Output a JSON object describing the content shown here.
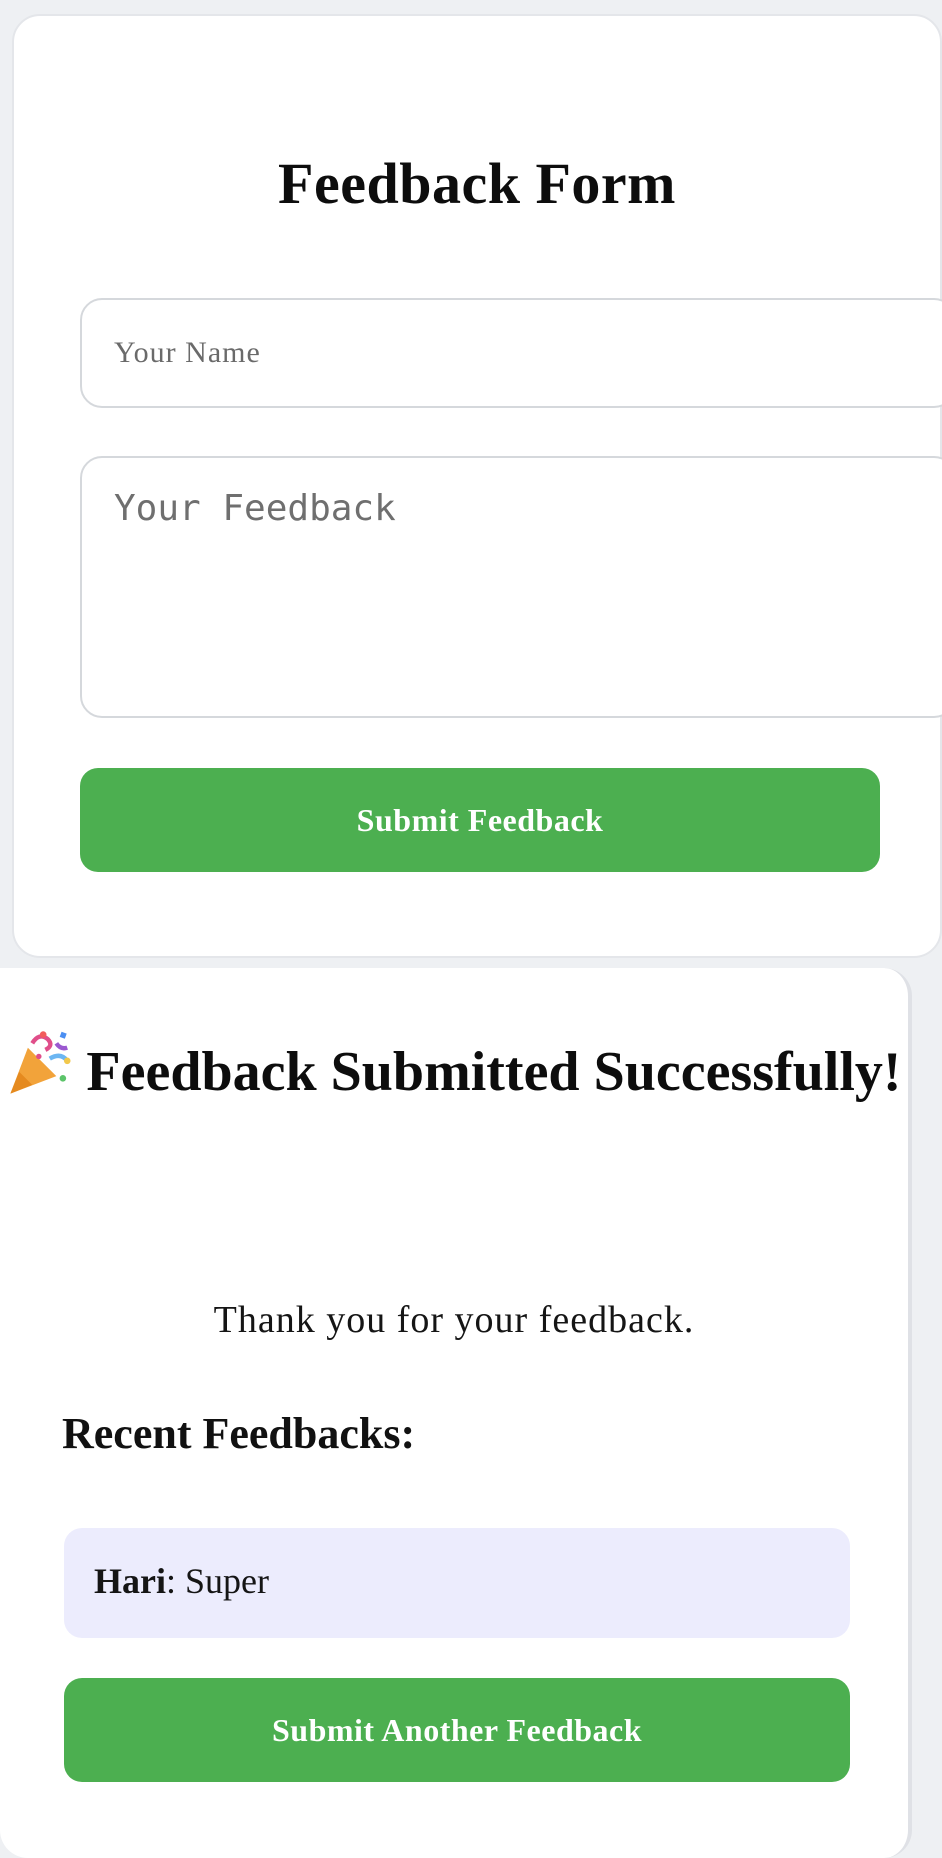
{
  "form": {
    "title": "Feedback Form",
    "name_placeholder": "Your Name",
    "feedback_placeholder": "Your Feedback",
    "submit_label": "Submit Feedback"
  },
  "success": {
    "icon": "party-popper-icon",
    "title": "Feedback Submitted Successfully!",
    "message": "Thank you for your feedback.",
    "recent_heading": "Recent Feedbacks:",
    "items": [
      {
        "name": "Hari",
        "separator": ":",
        "text": "Super"
      }
    ],
    "another_label": "Submit Another Feedback"
  },
  "colors": {
    "button_green": "#4caf50",
    "feedback_item_bg": "#ececfd",
    "page_bg": "#eef0f3"
  }
}
